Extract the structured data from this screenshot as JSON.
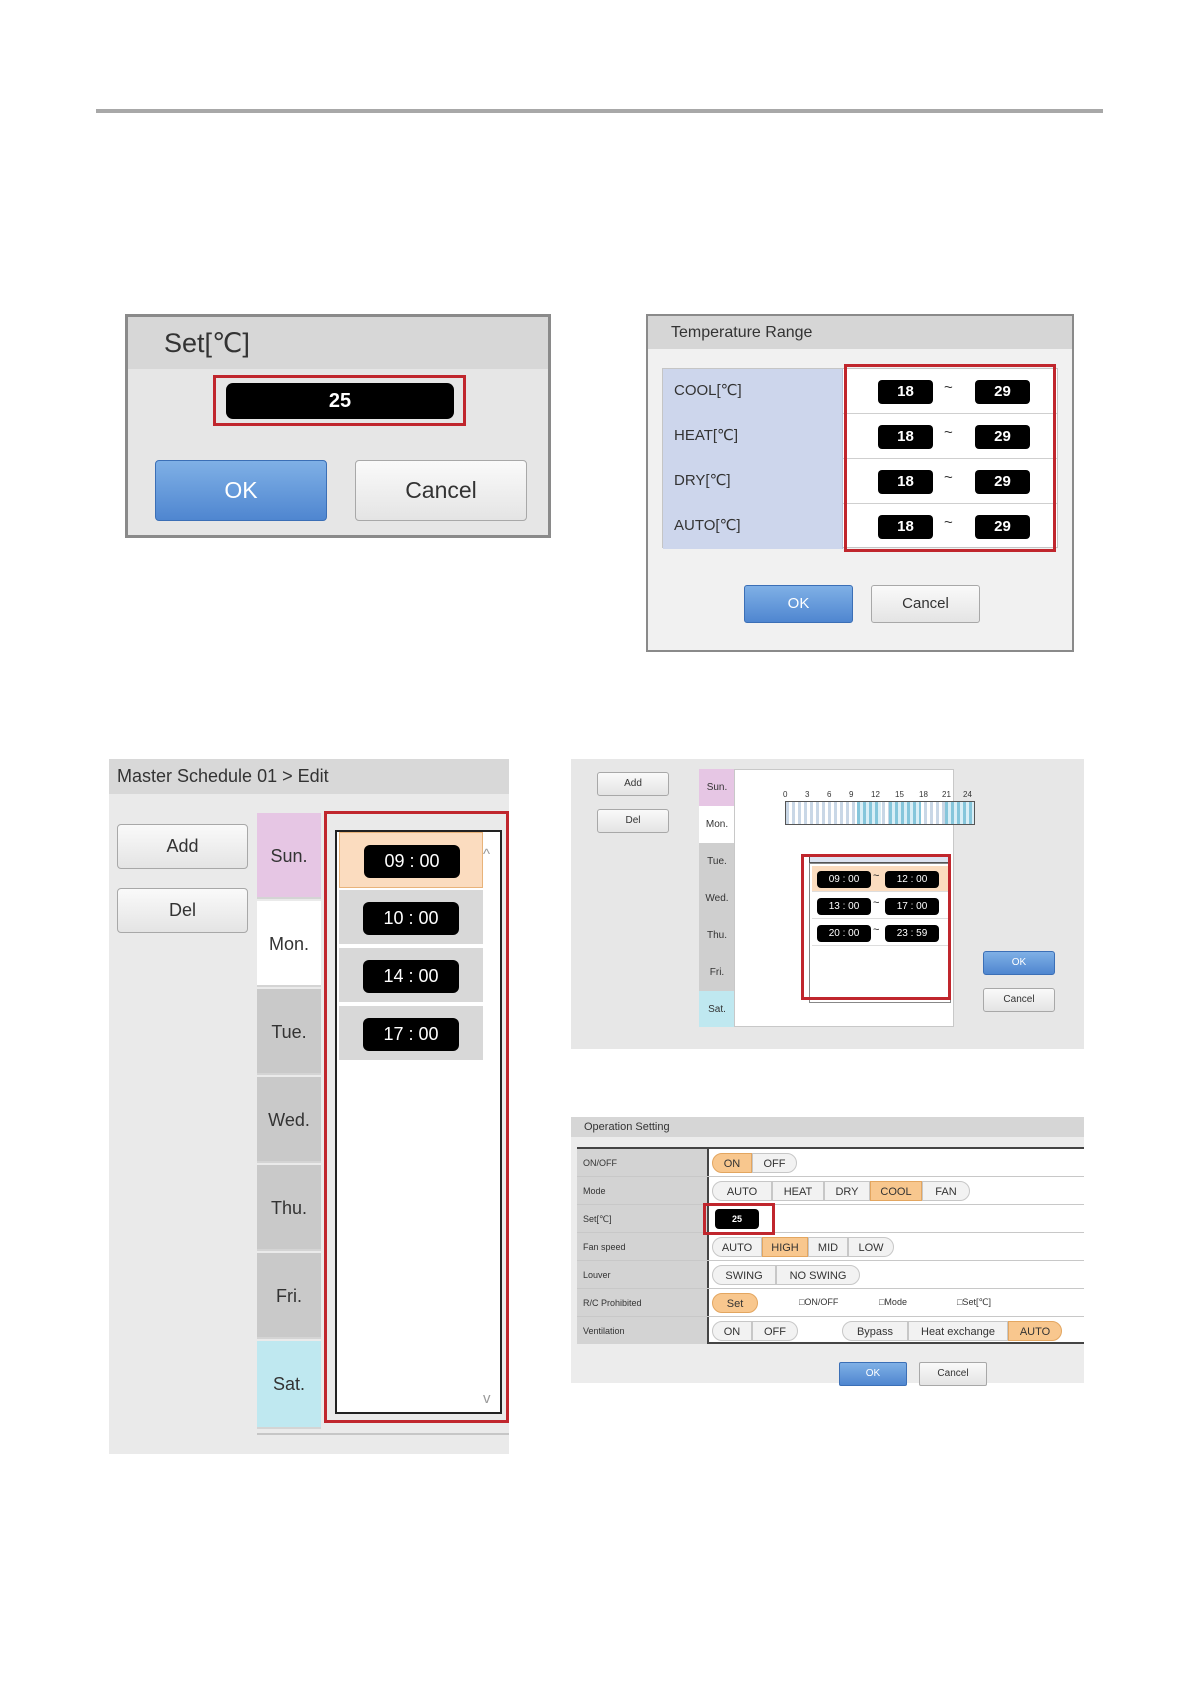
{
  "set_dialog": {
    "title": "Set[℃]",
    "value": "25",
    "ok_label": "OK",
    "cancel_label": "Cancel"
  },
  "temp_range": {
    "title": "Temperature Range",
    "rows": [
      {
        "label": "COOL[℃]",
        "min": "18",
        "max": "29"
      },
      {
        "label": "HEAT[℃]",
        "min": "18",
        "max": "29"
      },
      {
        "label": "DRY[℃]",
        "min": "18",
        "max": "29"
      },
      {
        "label": "AUTO[℃]",
        "min": "18",
        "max": "29"
      }
    ],
    "tilde": "~",
    "ok_label": "OK",
    "cancel_label": "Cancel"
  },
  "master_schedule": {
    "title": "Master Schedule 01 > Edit",
    "add_label": "Add",
    "del_label": "Del",
    "days": [
      "Sun.",
      "Mon.",
      "Tue.",
      "Wed.",
      "Thu.",
      "Fri.",
      "Sat."
    ],
    "times": [
      "09 : 00",
      "10 : 00",
      "14 : 00",
      "17 : 00"
    ],
    "scroll_up": "^",
    "scroll_down": "v"
  },
  "weekly": {
    "add_label": "Add",
    "del_label": "Del",
    "days": [
      "Sun.",
      "Mon.",
      "Tue.",
      "Wed.",
      "Thu.",
      "Fri.",
      "Sat."
    ],
    "hours": [
      "0",
      "3",
      "6",
      "9",
      "12",
      "15",
      "18",
      "21",
      "24"
    ],
    "periods": [
      {
        "start": "09 : 00",
        "end": "12 : 00"
      },
      {
        "start": "13 : 00",
        "end": "17 : 00"
      },
      {
        "start": "20 : 00",
        "end": "23 : 59"
      }
    ],
    "tilde": "~",
    "ok_label": "OK",
    "cancel_label": "Cancel"
  },
  "operation": {
    "title": "Operation Setting",
    "rows": {
      "onoff": {
        "label": "ON/OFF",
        "options": [
          "ON",
          "OFF"
        ],
        "selected": "ON"
      },
      "mode": {
        "label": "Mode",
        "options": [
          "AUTO",
          "HEAT",
          "DRY",
          "COOL",
          "FAN"
        ],
        "selected": "COOL"
      },
      "set": {
        "label": "Set[℃]",
        "value": "25"
      },
      "fan": {
        "label": "Fan speed",
        "options": [
          "AUTO",
          "HIGH",
          "MID",
          "LOW"
        ],
        "selected": "HIGH"
      },
      "louver": {
        "label": "Louver",
        "options": [
          "SWING",
          "NO SWING"
        ]
      },
      "rc": {
        "label": "R/C Prohibited",
        "button": "Set",
        "checks": [
          "□ON/OFF",
          "□Mode",
          "□Set[℃]"
        ]
      },
      "vent": {
        "label": "Ventilation",
        "options": [
          "ON",
          "OFF"
        ],
        "modes": [
          "Bypass",
          "Heat exchange",
          "AUTO"
        ],
        "selected_mode": "AUTO"
      }
    },
    "ok_label": "OK",
    "cancel_label": "Cancel"
  },
  "colors": {
    "highlight_red": "#c0262d",
    "selected_orange": "#f8c78e",
    "ok_blue": "#4f86d0",
    "sun_pink": "#e6c6e4",
    "sat_cyan": "#bfe8f0"
  }
}
